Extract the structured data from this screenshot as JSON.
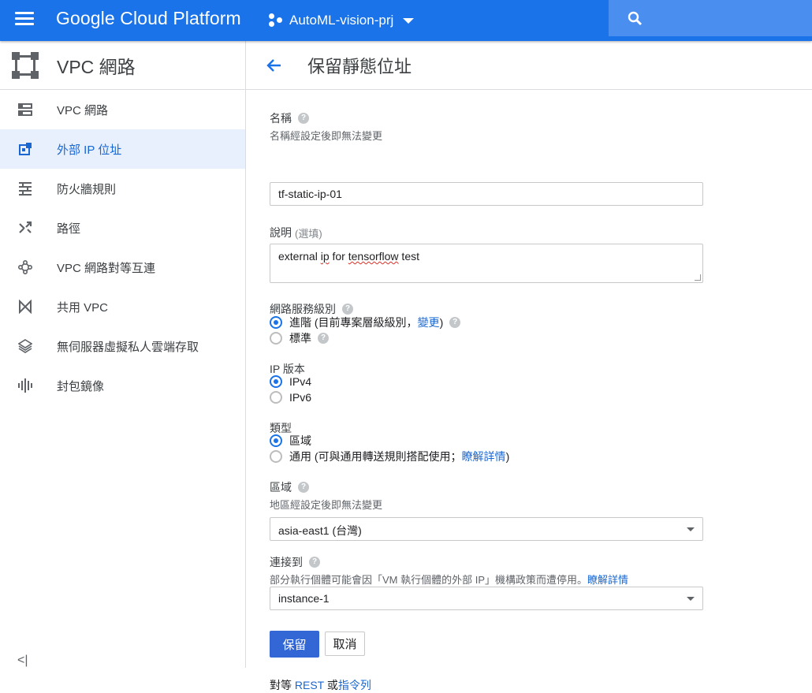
{
  "topbar": {
    "brand": "Google Cloud Platform",
    "project": "AutoML-vision-prj",
    "accent": "#1a73e8"
  },
  "sidebar": {
    "title": "VPC 網路",
    "items": [
      {
        "label": "VPC 網路",
        "icon": "vpc-network-icon"
      },
      {
        "label": "外部 IP 位址",
        "icon": "external-ip-icon",
        "active": true
      },
      {
        "label": "防火牆規則",
        "icon": "firewall-icon"
      },
      {
        "label": "路徑",
        "icon": "routes-icon"
      },
      {
        "label": "VPC 網路對等互連",
        "icon": "peering-icon"
      },
      {
        "label": "共用 VPC",
        "icon": "shared-vpc-icon"
      },
      {
        "label": "無伺服器虛擬私人雲端存取",
        "icon": "serverless-icon"
      },
      {
        "label": "封包鏡像",
        "icon": "packet-mirroring-icon"
      }
    ],
    "collapse_label": "<|"
  },
  "page": {
    "title": "保留靜態位址"
  },
  "form": {
    "name": {
      "label": "名稱",
      "hint": "名稱經設定後即無法變更",
      "value": "tf-static-ip-01"
    },
    "description": {
      "label": "說明",
      "optional": "(選填)",
      "value_prefix": "external ",
      "value_ip": "ip",
      "value_mid": " for ",
      "value_tf": "tensorflow",
      "value_suffix": " test"
    },
    "tier": {
      "label": "網路服務級別",
      "premium_label": "進階 (目前專案層級級別，",
      "premium_link": "變更",
      "premium_close": ")",
      "standard_label": "標準",
      "selected": "premium"
    },
    "ip_version": {
      "label": "IP 版本",
      "options": [
        "IPv4",
        "IPv6"
      ],
      "selected": "IPv4"
    },
    "type": {
      "label": "類型",
      "regional": "區域",
      "global_prefix": "通用 (可與通用轉送規則搭配使用；",
      "global_link": "瞭解詳情",
      "global_close": ")",
      "selected": "regional"
    },
    "region": {
      "label": "區域",
      "hint": "地區經設定後即無法變更",
      "value": "asia-east1 (台灣)"
    },
    "attached": {
      "label": "連接到",
      "hint": "部分執行個體可能會因「VM 執行個體的外部 IP」機構政策而遭停用。",
      "hint_link": "瞭解詳情",
      "value": "instance-1"
    },
    "buttons": {
      "reserve": "保留",
      "cancel": "取消"
    },
    "footer": {
      "prefix": "對等 ",
      "rest": "REST",
      "or": " 或",
      "cli": "指令列"
    }
  }
}
